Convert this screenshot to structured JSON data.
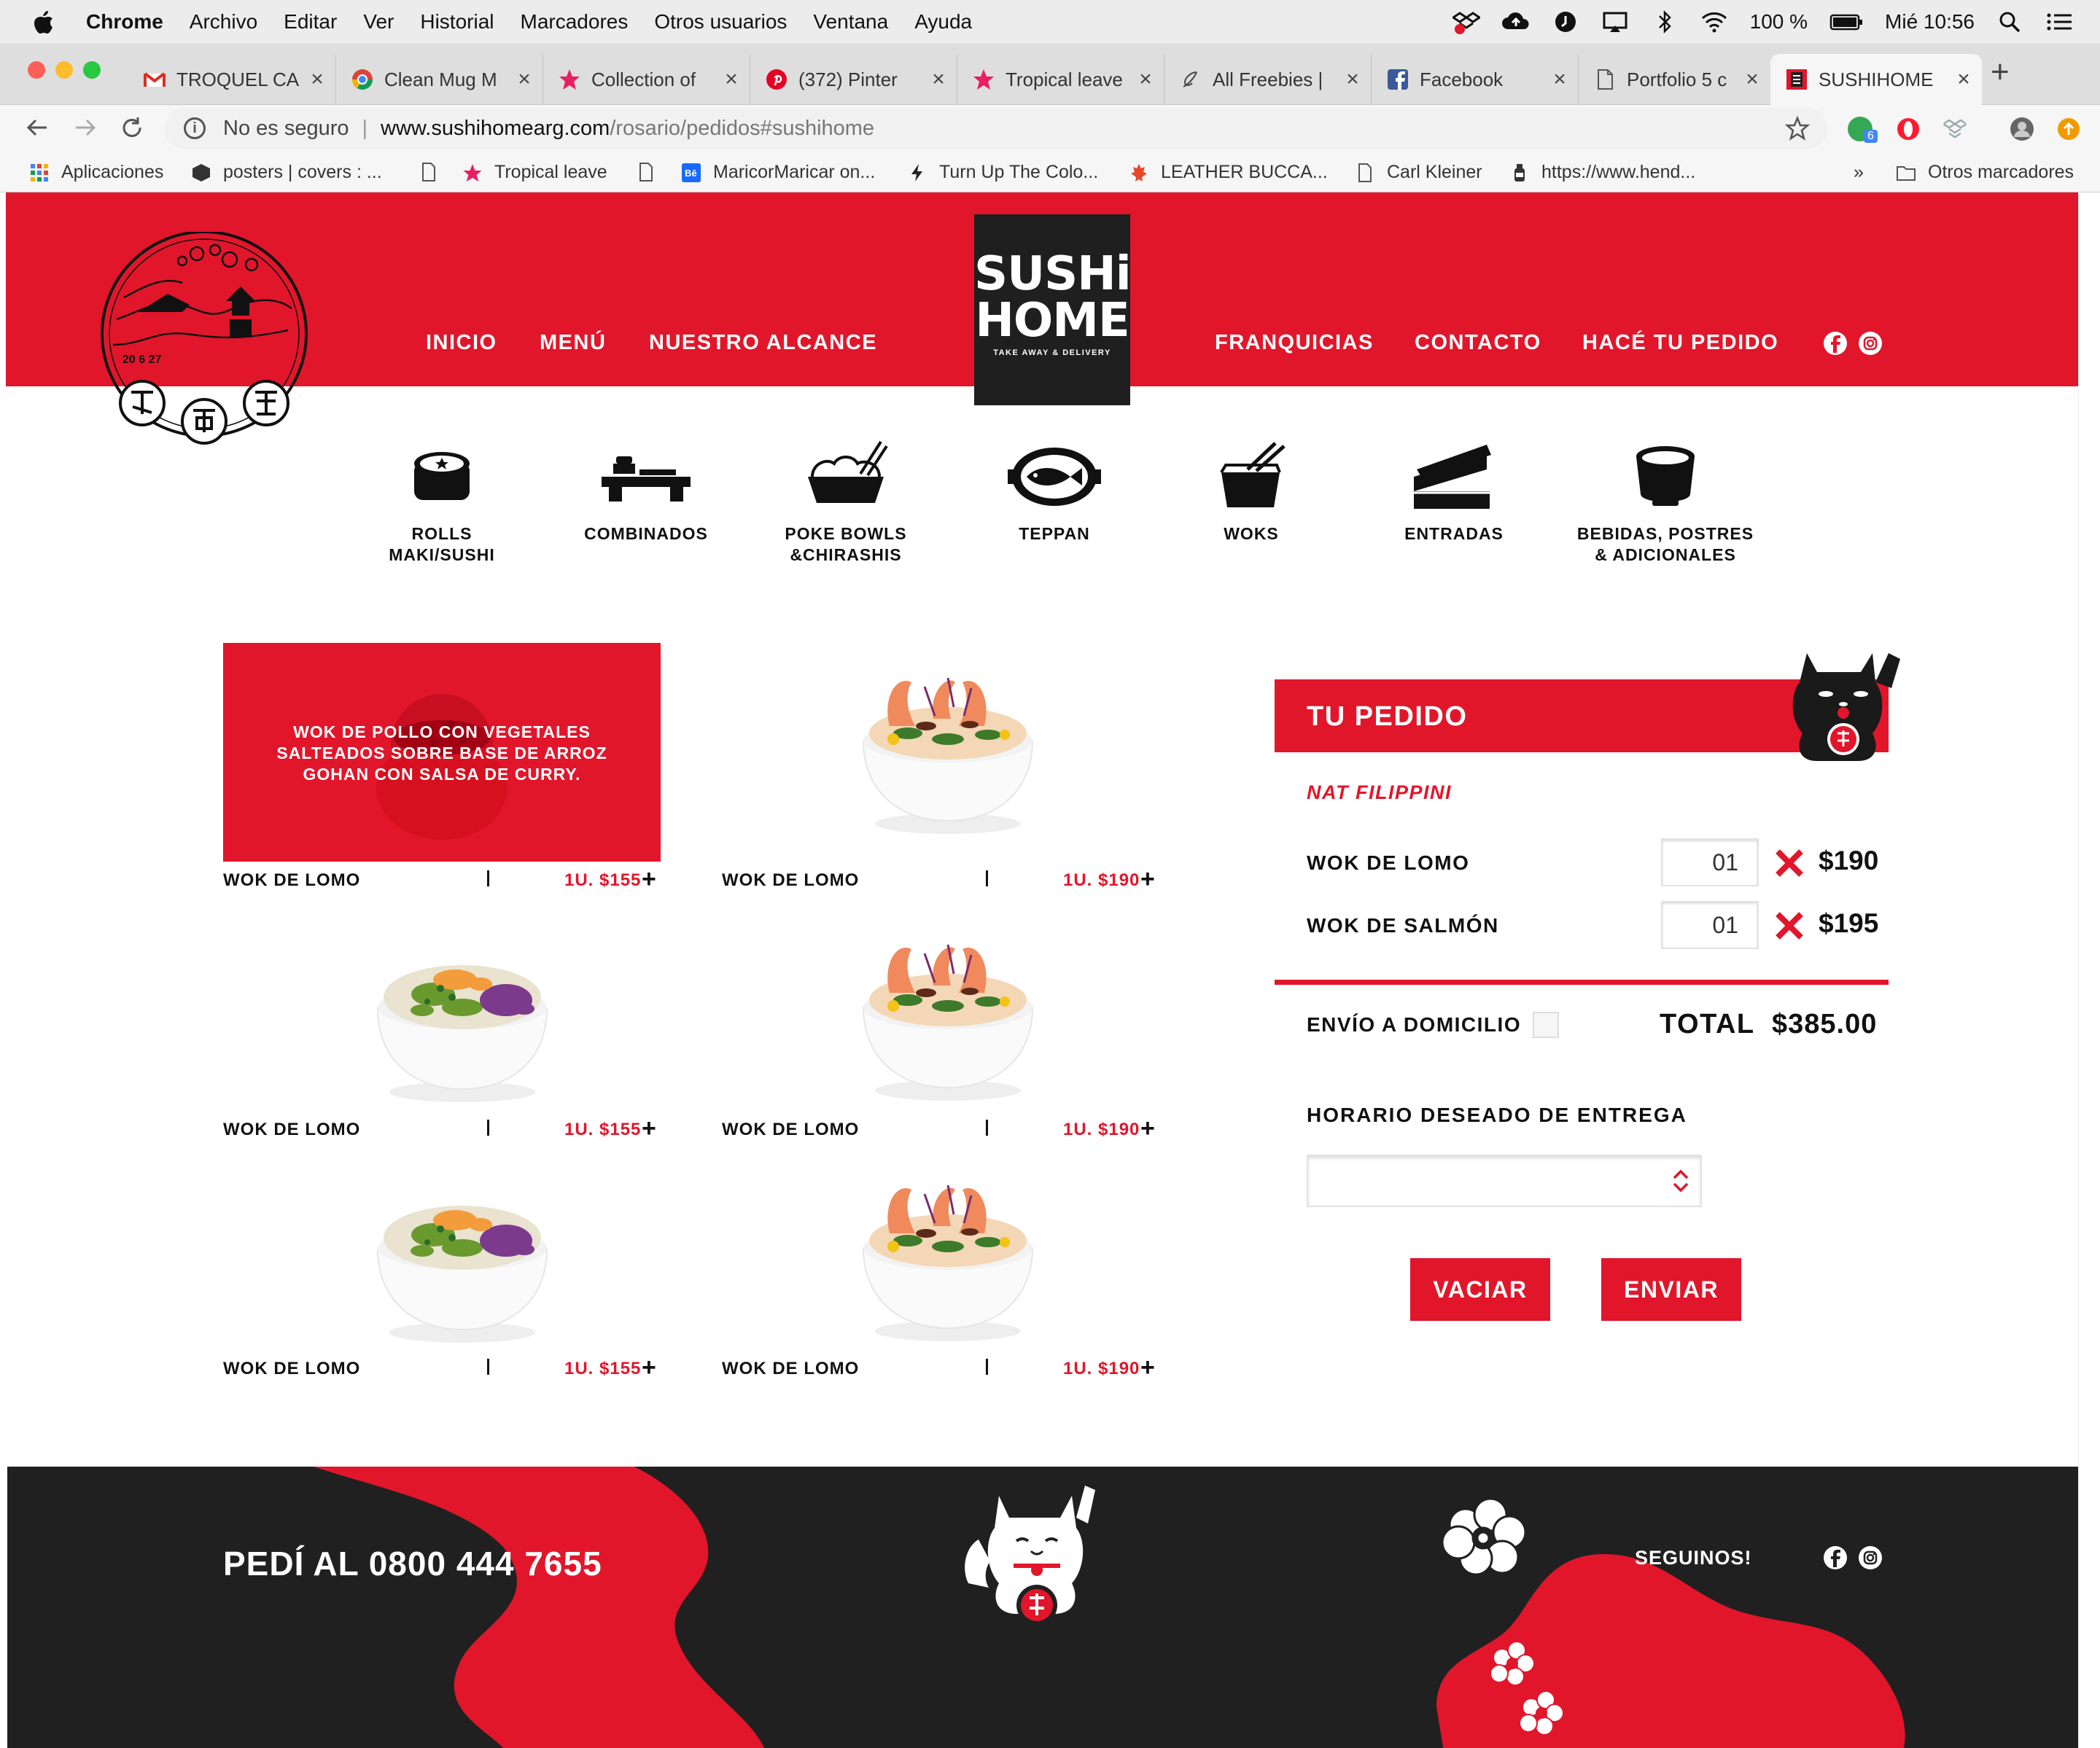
{
  "menubar": {
    "app": "Chrome",
    "items": [
      "Archivo",
      "Editar",
      "Ver",
      "Historial",
      "Marcadores",
      "Otros usuarios",
      "Ventana",
      "Ayuda"
    ],
    "battery": "100 %",
    "clock": "Mié 10:56"
  },
  "tabs": [
    {
      "title": "TROQUEL CA",
      "icon": "gmail-icon"
    },
    {
      "title": "Clean Mug M",
      "icon": "chrome-icon"
    },
    {
      "title": "Collection of",
      "icon": "star-icon"
    },
    {
      "title": "(372) Pinter",
      "icon": "pinterest-icon"
    },
    {
      "title": "Tropical leave",
      "icon": "star-icon"
    },
    {
      "title": "All Freebies |",
      "icon": "script-icon"
    },
    {
      "title": "Facebook",
      "icon": "facebook-icon"
    },
    {
      "title": "Portfolio 5 c",
      "icon": "page-icon"
    },
    {
      "title": "SUSHIHOME",
      "icon": "sushihome-icon"
    }
  ],
  "toolbar": {
    "security": "No es seguro",
    "url_host": "www.sushihomearg.com",
    "url_path": "/rosario/pedidos#sushihome",
    "ext_badge": "6"
  },
  "bookmarks": {
    "items": [
      "Aplicaciones",
      "posters | covers : ...",
      "Tropical leave",
      "MaricorMaricar on...",
      "Turn Up The Colo...",
      "LEATHER BUCCA...",
      "Carl Kleiner",
      "https://www.hend..."
    ],
    "more": "»",
    "others": "Otros marcadores"
  },
  "site": {
    "nav_left": [
      "INICIO",
      "MENÚ",
      "NUESTRO ALCANCE"
    ],
    "nav_right": [
      "FRANQUICIAS",
      "CONTACTO",
      "HACÉ TU PEDIDO"
    ],
    "logo_line1": "SUSHi",
    "logo_line2": "HOME",
    "logo_tagline": "TAKE AWAY & DELIVERY",
    "stamp_date": "20  6  27",
    "brand_red": "#e1162b",
    "brand_dark": "#1f1f1f"
  },
  "categories": [
    {
      "line1": "ROLLS",
      "line2": "MAKI/SUSHI",
      "icon": "sushi-roll-icon"
    },
    {
      "line1": "COMBINADOS",
      "line2": "",
      "icon": "combo-tray-icon"
    },
    {
      "line1": "POKE BOWLS",
      "line2": "&CHIRASHIS",
      "icon": "poke-bowl-icon"
    },
    {
      "line1": "TEPPAN",
      "line2": "",
      "icon": "teppan-fish-icon"
    },
    {
      "line1": "WOKS",
      "line2": "",
      "icon": "wok-box-icon"
    },
    {
      "line1": "ENTRADAS",
      "line2": "",
      "icon": "entradas-boxes-icon"
    },
    {
      "line1": "BEBIDAS, POSTRES",
      "line2": "& ADICIONALES",
      "icon": "drink-cup-icon"
    }
  ],
  "products": [
    {
      "name": "WOK DE LOMO",
      "price": "1U. $155",
      "description": "WOK DE POLLO CON VEGETALES SALTEADOS SOBRE BASE DE ARROZ GOHAN CON SALSA DE CURRY.",
      "image": "red-rice-bowl"
    },
    {
      "name": "WOK DE LOMO",
      "price": "1U. $190",
      "image": "shrimp-bowl"
    },
    {
      "name": "WOK DE LOMO",
      "price": "1U. $155",
      "image": "veggie-bowl"
    },
    {
      "name": "WOK DE LOMO",
      "price": "1U. $190",
      "image": "shrimp-bowl"
    },
    {
      "name": "WOK DE LOMO",
      "price": "1U. $155",
      "image": "veggie-bowl"
    },
    {
      "name": "WOK DE LOMO",
      "price": "1U. $190",
      "image": "shrimp-bowl"
    }
  ],
  "order": {
    "title": "TU PEDIDO",
    "customer": "NAT FILIPPINI",
    "items": [
      {
        "name": "WOK DE LOMO",
        "qty": "01",
        "price": "$190"
      },
      {
        "name": "WOK DE SALMÓN",
        "qty": "01",
        "price": "$195"
      }
    ],
    "shipping_label": "ENVÍO A DOMICILIO",
    "total_label": "TOTAL",
    "total_value": "$385.00",
    "delivery_label": "HORARIO DESEADO DE ENTREGA",
    "delivery_value": "",
    "clear_label": "VACIAR",
    "send_label": "ENVIAR"
  },
  "footer": {
    "phone_text": "PEDÍ AL 0800 444 7655",
    "follow_text": "SEGUINOS!"
  }
}
